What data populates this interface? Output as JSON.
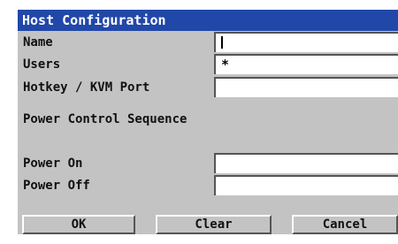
{
  "dialog": {
    "title": "Host Configuration",
    "fields": [
      {
        "label": "Name",
        "value": ""
      },
      {
        "label": "Users",
        "value": "*"
      },
      {
        "label": "Hotkey / KVM Port",
        "value": ""
      }
    ],
    "section_label": "Power Control Sequence",
    "power_fields": [
      {
        "label": "Power On",
        "value": ""
      },
      {
        "label": "Power Off",
        "value": ""
      }
    ],
    "buttons": {
      "ok": "OK",
      "clear": "Clear",
      "cancel": "Cancel"
    }
  },
  "colors": {
    "title_bar": "#2147a8",
    "dialog_bg": "#c3c3c3",
    "field_bg": "#ffffff"
  }
}
